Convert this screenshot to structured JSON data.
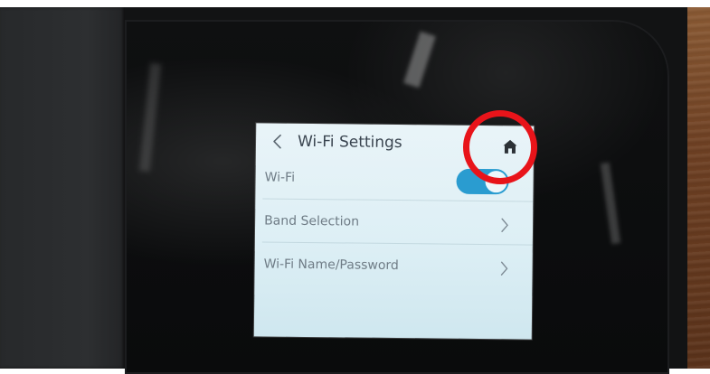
{
  "screen": {
    "title": "Wi-Fi Settings",
    "rows": [
      {
        "label": "Wi-Fi",
        "control": "toggle",
        "state": "on"
      },
      {
        "label": "Band Selection",
        "control": "chevron"
      },
      {
        "label": "Wi-Fi Name/Password",
        "control": "chevron"
      }
    ]
  },
  "icons": {
    "back": "chevron-left-icon",
    "home": "home-icon",
    "row_action": "chevron-right-icon"
  },
  "colors": {
    "screen_bg": "#e1f0f5",
    "title_text": "#3a4550",
    "label_text": "#6f7c86",
    "toggle_on": "#2a9cd0",
    "annotation": "#e8141a"
  },
  "annotation": {
    "shape": "circle",
    "target": "home-icon"
  }
}
